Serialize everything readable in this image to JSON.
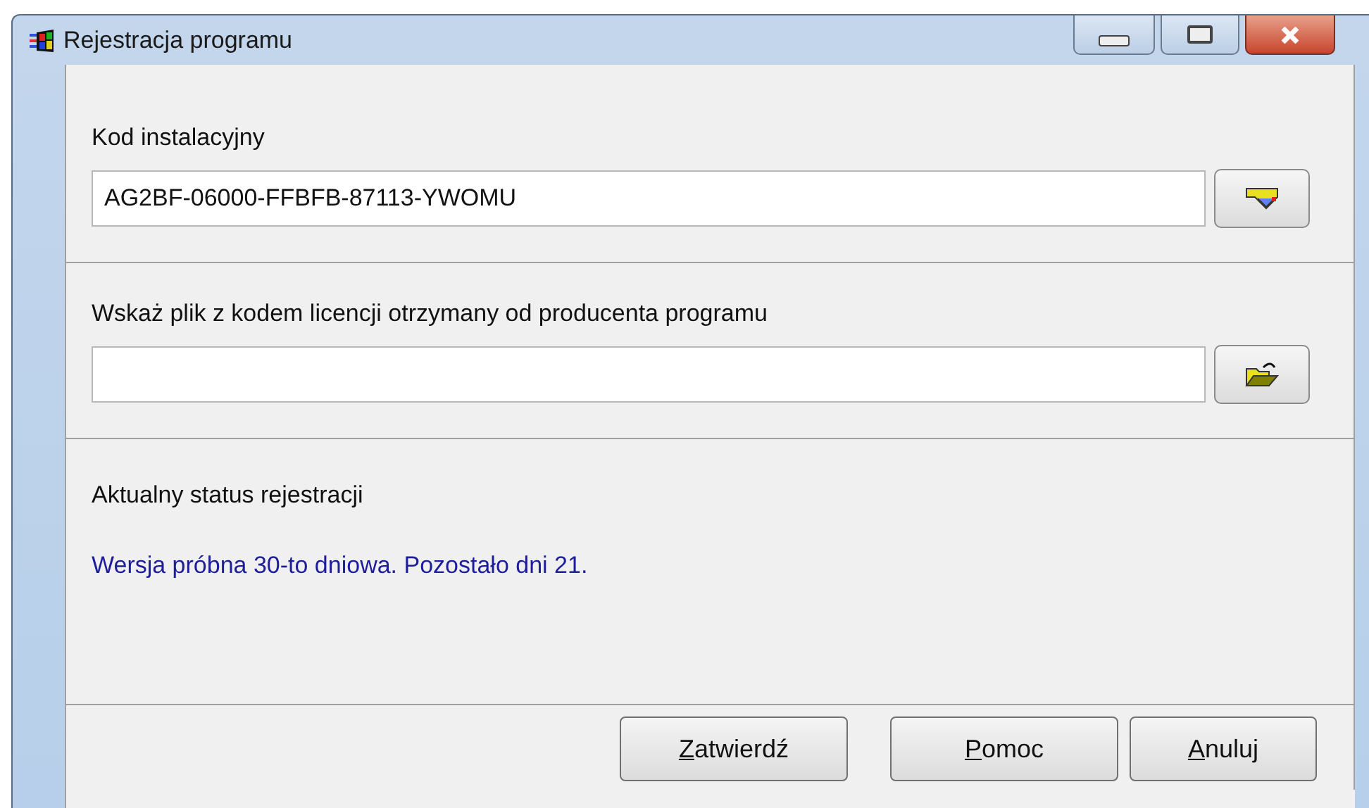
{
  "window": {
    "title": "Rejestracja programu"
  },
  "installation_code": {
    "label": "Kod instalacyjny",
    "value": "AG2BF-06000-FFBFB-87113-YWOMU"
  },
  "license_file": {
    "label": "Wskaż plik z kodem licencji otrzymany od producenta programu"
  },
  "status": {
    "label": "Aktualny status rejestracji",
    "message": "Wersja próbna 30-to dniowa. Pozostało dni 21."
  },
  "buttons": [
    {
      "label": "Zatwierdź"
    },
    {
      "label": "Pomoc"
    },
    {
      "label": "Anuluj"
    }
  ]
}
